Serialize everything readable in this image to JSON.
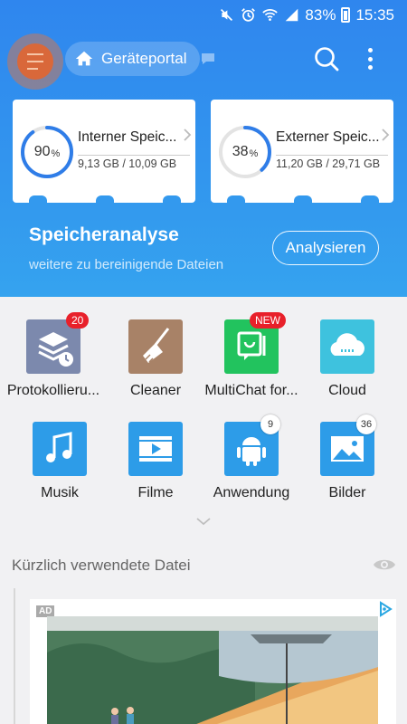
{
  "status_bar": {
    "battery": "83%",
    "time": "15:35"
  },
  "toolbar": {
    "portal_label": "Geräteportal"
  },
  "storage": [
    {
      "percent": "90",
      "percent_sign": "%",
      "progress": 0.9,
      "title": "Interner Speic...",
      "size": "9,13 GB / 10,09 GB"
    },
    {
      "percent": "38",
      "percent_sign": "%",
      "progress": 0.38,
      "title": "Externer Speic...",
      "size": "11,20 GB / 29,71 GB"
    }
  ],
  "analysis": {
    "title": "Speicheranalyse",
    "subtitle": "weitere zu bereinigende Dateien",
    "button": "Analysieren"
  },
  "apps": [
    {
      "label": "Protokollieru...",
      "icon": "log-icon",
      "badge": "20"
    },
    {
      "label": "Cleaner",
      "icon": "broom-icon"
    },
    {
      "label": "MultiChat for...",
      "icon": "multichat-icon",
      "badge": "NEW"
    },
    {
      "label": "Cloud",
      "icon": "cloud-icon"
    },
    {
      "label": "Musik",
      "icon": "music-icon"
    },
    {
      "label": "Filme",
      "icon": "film-icon"
    },
    {
      "label": "Anwendung",
      "icon": "android-icon",
      "badge": "9"
    },
    {
      "label": "Bilder",
      "icon": "image-icon",
      "badge": "36"
    }
  ],
  "recent": {
    "title": "Kürzlich verwendete Datei"
  },
  "ad": {
    "label": "AD"
  },
  "colors": {
    "accent": "#2f86ee",
    "menu": "#d9683a",
    "badge": "#e8202a"
  }
}
